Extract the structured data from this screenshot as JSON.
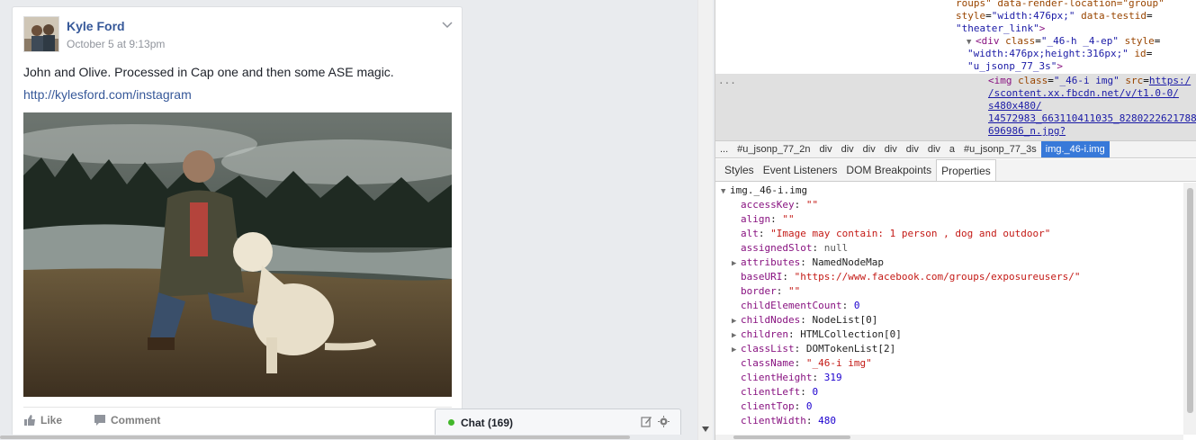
{
  "post": {
    "author": "Kyle Ford",
    "timestamp": "October 5 at 9:13pm",
    "text": "John and Olive. Processed in Cap one and then some ASE magic.",
    "link": "http://kylesford.com/instagram",
    "actions": {
      "like": "Like",
      "comment": "Comment"
    }
  },
  "chat": {
    "label": "Chat (169)"
  },
  "devtools": {
    "dom": {
      "line1": "roups\" data-render-location=\"group\"",
      "line2_attr": "style",
      "line2_val": "\"width:476px;\"",
      "line2_attr2": "data-testid",
      "line3_val": "\"theater_link\"",
      "line3_tag": ">",
      "line4_tag": "<div",
      "line4_attr": "class",
      "line4_val": "\"_46-h _4-ep\"",
      "line4_attr2": "style",
      "line5_val": "\"width:476px;height:316px;\"",
      "line5_attr": "id",
      "line6_val": "\"u_jsonp_77_3s\"",
      "line6_tag": ">",
      "img_tag": "<img",
      "img_attr": "class",
      "img_class_val": "\"_46-i img\"",
      "img_src_attr": "src",
      "src1": "https:/",
      "src2": "/scontent.xx.fbcdn.net/v/t1.0-0/",
      "src3": "s480x480/",
      "src4": "14572983_663110411035_8280222621788",
      "src5": "696986_n.jpg?",
      "ellipsis": "..."
    },
    "breadcrumbs": [
      "...",
      "#u_jsonp_77_2n",
      "div",
      "div",
      "div",
      "div",
      "div",
      "div",
      "a",
      "#u_jsonp_77_3s",
      "img._46-i.img"
    ],
    "sidebar_tabs": [
      "Styles",
      "Event Listeners",
      "DOM Breakpoints",
      "Properties"
    ],
    "active_tab": "Properties",
    "properties": {
      "header": "img._46-i.img",
      "rows": [
        {
          "key": "accessKey",
          "value": "\"\"",
          "kind": "str",
          "expandable": false
        },
        {
          "key": "align",
          "value": "\"\"",
          "kind": "str",
          "expandable": false
        },
        {
          "key": "alt",
          "value": "\"Image may contain: 1 person , dog and outdoor\"",
          "kind": "str",
          "expandable": false
        },
        {
          "key": "assignedSlot",
          "value": "null",
          "kind": "null",
          "expandable": false
        },
        {
          "key": "attributes",
          "value": "NamedNodeMap",
          "kind": "obj",
          "expandable": true
        },
        {
          "key": "baseURI",
          "value": "\"https://www.facebook.com/groups/exposureusers/\"",
          "kind": "str",
          "expandable": false
        },
        {
          "key": "border",
          "value": "\"\"",
          "kind": "str",
          "expandable": false
        },
        {
          "key": "childElementCount",
          "value": "0",
          "kind": "num",
          "expandable": false
        },
        {
          "key": "childNodes",
          "value": "NodeList[0]",
          "kind": "obj",
          "expandable": true
        },
        {
          "key": "children",
          "value": "HTMLCollection[0]",
          "kind": "obj",
          "expandable": true
        },
        {
          "key": "classList",
          "value": "DOMTokenList[2]",
          "kind": "obj",
          "expandable": true
        },
        {
          "key": "className",
          "value": "\"_46-i img\"",
          "kind": "str",
          "expandable": false
        },
        {
          "key": "clientHeight",
          "value": "319",
          "kind": "num",
          "expandable": false
        },
        {
          "key": "clientLeft",
          "value": "0",
          "kind": "num",
          "expandable": false
        },
        {
          "key": "clientTop",
          "value": "0",
          "kind": "num",
          "expandable": false
        },
        {
          "key": "clientWidth",
          "value": "480",
          "kind": "num",
          "expandable": false
        }
      ]
    }
  },
  "colors": {
    "fb_link": "#365899",
    "devtools_selected": "#3879d9",
    "chat_online": "#42b72a"
  },
  "icons": [
    "post-menu-chevron-icon",
    "like-thumb-icon",
    "comment-bubble-icon",
    "chat-compose-icon",
    "chat-settings-gear-icon",
    "expand-triangle-icon",
    "scroll-down-arrow-icon"
  ]
}
